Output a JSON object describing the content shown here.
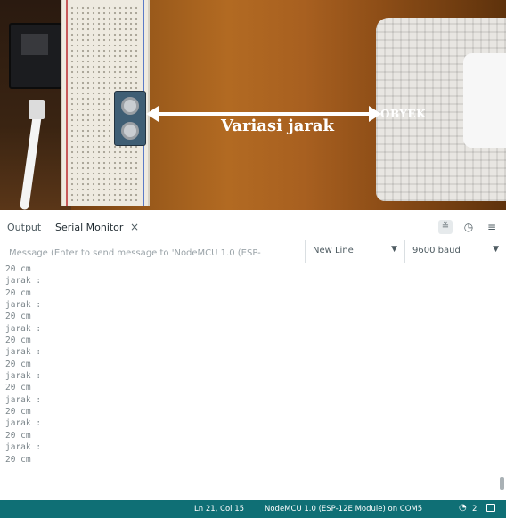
{
  "photo": {
    "arrow_label": "Variasi jarak",
    "object_label": "OBYEK"
  },
  "panel": {
    "tabs": [
      {
        "label": "Output"
      },
      {
        "label": "Serial Monitor"
      }
    ],
    "icons": {
      "close": "close-icon",
      "toggle_autoscroll": "autoscroll-icon",
      "toggle_timestamp": "clock-icon",
      "menu": "menu-icon"
    }
  },
  "toolbar": {
    "message_placeholder": "Message (Enter to send message to 'NodeMCU 1.0 (ESP-",
    "line_ending": "New Line",
    "baud_rate": "9600 baud"
  },
  "output": {
    "lines": [
      "20 cm",
      "jarak :",
      "20 cm",
      "jarak :",
      "20 cm",
      "jarak :",
      "20 cm",
      "jarak :",
      "20 cm",
      "jarak :",
      "20 cm",
      "jarak :",
      "20 cm",
      "jarak :",
      "20 cm",
      "jarak :",
      "20 cm"
    ]
  },
  "statusbar": {
    "position": "Ln 21, Col 15",
    "board": "NodeMCU 1.0 (ESP-12E Module) on COM5",
    "notifications": "2",
    "accent_color": "#0f6f75"
  }
}
